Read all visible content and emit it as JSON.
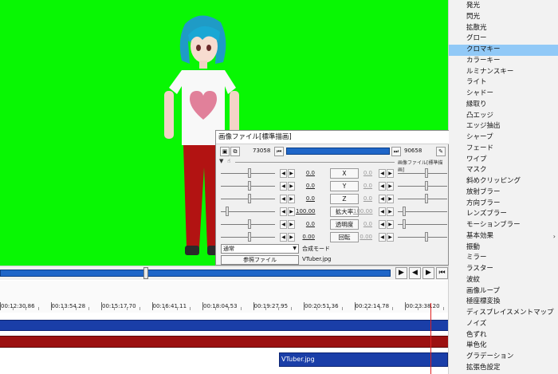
{
  "dialog": {
    "title": "画像ファイル[標準描画]",
    "frame_start": "73058",
    "frame_end": "90658",
    "object_label": "画像ファイル[標準描画]",
    "params": [
      {
        "label": "X",
        "start": "0.0",
        "end": "0.0"
      },
      {
        "label": "Y",
        "start": "0.0",
        "end": "0.0"
      },
      {
        "label": "Z",
        "start": "0.0",
        "end": "0.0"
      },
      {
        "label": "拡大率",
        "start": "100.00",
        "end": "100.00"
      },
      {
        "label": "透明度",
        "start": "0.0",
        "end": "0.0"
      },
      {
        "label": "回転",
        "start": "0.00",
        "end": "0.00"
      }
    ],
    "blend_mode_value": "通常",
    "blend_mode_label": "合成モード",
    "reference_button": "参照ファイル",
    "file_name": "VTuber.jpg"
  },
  "timeline": {
    "times": [
      "00:12:30.86",
      "00:13:54.28",
      "00:15:17.70",
      "00:16:41.11",
      "00:18:04.53",
      "00:19:27.95",
      "00:20:51.36",
      "00:22:14.78",
      "00:23:38.20"
    ],
    "clip_label": "VTuber.jpg"
  },
  "filters": [
    {
      "label": "発光"
    },
    {
      "label": "閃光"
    },
    {
      "label": "拡散光"
    },
    {
      "label": "グロー"
    },
    {
      "label": "クロマキー"
    },
    {
      "label": "カラーキー"
    },
    {
      "label": "ルミナンスキー"
    },
    {
      "label": "ライト"
    },
    {
      "label": "シャドー"
    },
    {
      "label": "縁取り"
    },
    {
      "label": "凸エッジ"
    },
    {
      "label": "エッジ抽出"
    },
    {
      "label": "シャープ"
    },
    {
      "label": "フェード"
    },
    {
      "label": "ワイプ"
    },
    {
      "label": "マスク"
    },
    {
      "label": "斜めクリッピング"
    },
    {
      "label": "放射ブラー"
    },
    {
      "label": "方向ブラー"
    },
    {
      "label": "レンズブラー"
    },
    {
      "label": "モーションブラー"
    },
    {
      "label": "基本効果"
    },
    {
      "label": "振動"
    },
    {
      "label": "ミラー"
    },
    {
      "label": "ラスター"
    },
    {
      "label": "波紋"
    },
    {
      "label": "画像ループ"
    },
    {
      "label": "極座標変換"
    },
    {
      "label": "ディスプレイスメントマップ"
    },
    {
      "label": "ノイズ"
    },
    {
      "label": "色ずれ"
    },
    {
      "label": "単色化"
    },
    {
      "label": "グラデーション"
    },
    {
      "label": "拡張色設定"
    }
  ],
  "filter_selected_index": 4,
  "filter_submenu_index": 21,
  "colors": {
    "chroma_green": "#08f703",
    "selection": "#91c9f7",
    "track_blue": "#1a3ea8",
    "track_red": "#9c1111",
    "seek_blue": "#1f66c8"
  },
  "icons": {
    "frame_prev": "⏮",
    "frame_next": "⏭",
    "play": "▶",
    "arrow_left": "◀",
    "arrow_right": "▶",
    "dropdown": "▼",
    "submenu": "›"
  }
}
